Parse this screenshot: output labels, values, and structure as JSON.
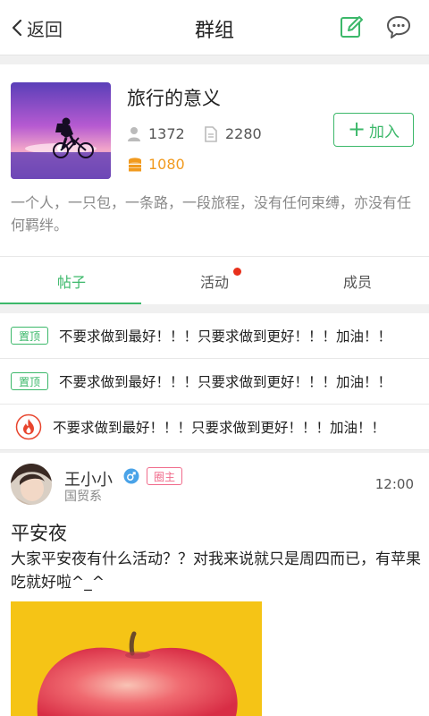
{
  "header": {
    "back_label": "返回",
    "title": "群组",
    "edit_icon": "edit-icon",
    "message_icon": "message-icon",
    "accent_color": "#3cb86a"
  },
  "group": {
    "name": "旅行的意义",
    "members_count": "1372",
    "posts_count": "2280",
    "coins": "1080",
    "join_label": "加入",
    "description": "一个人，一只包，一条路，一段旅程，没有任何束缚，亦没有任何羁绊。"
  },
  "tabs": [
    {
      "label": "帖子",
      "active": true
    },
    {
      "label": "活动",
      "has_dot": true
    },
    {
      "label": "成员"
    }
  ],
  "pinned_posts": [
    {
      "badge": "置顶",
      "text": "不要求做到最好！！！只要求做到更好！！！加油！！"
    },
    {
      "badge": "置顶",
      "text": "不要求做到最好！！！只要求做到更好！！！加油！！"
    },
    {
      "icon": "flame-icon",
      "text": "不要求做到最好！！！只要求做到更好！！！加油！！"
    }
  ],
  "post": {
    "author": "王小小",
    "gender_icon": "male-icon",
    "role": "圈主",
    "department": "国贸系",
    "time": "12:00",
    "title": "平安夜",
    "body": "大家平安夜有什么活动？？对我来说就只是周四而已，有苹果吃就好啦^_^"
  }
}
